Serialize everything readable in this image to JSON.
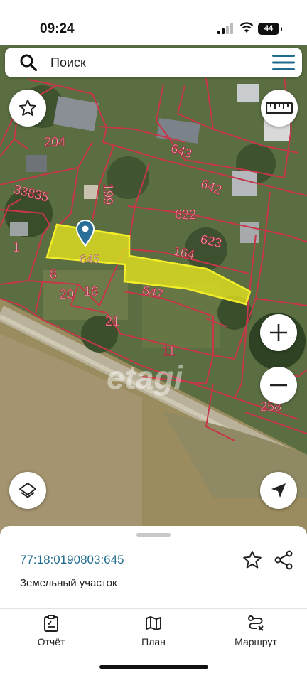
{
  "status_bar": {
    "time": "09:24",
    "battery": "44"
  },
  "search": {
    "placeholder": "Поиск"
  },
  "map": {
    "watermark": "etagi",
    "selected_parcel_label": "645",
    "parcel_labels": [
      "204",
      "643",
      "642",
      "199",
      "33835",
      "622",
      "623",
      "164",
      "1",
      "8",
      "20",
      "16",
      "647",
      "21",
      "11",
      "258"
    ],
    "colors": {
      "parcel_border": "#c8364a",
      "selected_fill": "#e7e61e",
      "label_fill": "#f8d6df",
      "pin": "#2a6f97"
    }
  },
  "sheet": {
    "cadastral_number": "77:18:0190803:645",
    "property_type": "Земельный участок",
    "page_dots": {
      "count": 2,
      "active": 0
    }
  },
  "tabs": [
    {
      "label": "Отчёт",
      "icon": "report-icon"
    },
    {
      "label": "План",
      "icon": "map-plan-icon"
    },
    {
      "label": "Маршрут",
      "icon": "route-icon"
    }
  ]
}
